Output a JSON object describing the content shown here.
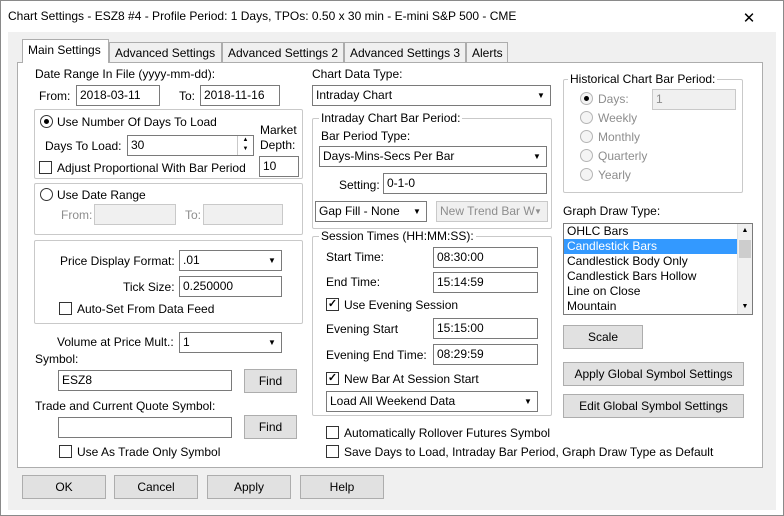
{
  "window": {
    "title": "Chart Settings - ESZ8  #4 - Profile Period: 1 Days, TPOs: 0.50 x 30 min   - E-mini S&P 500 - CME",
    "close_glyph": "✕"
  },
  "tabs": [
    "Main Settings",
    "Advanced Settings",
    "Advanced Settings 2",
    "Advanced Settings 3",
    "Alerts"
  ],
  "date_range": {
    "label": "Date Range In File (yyyy-mm-dd):",
    "from_label": "From:",
    "from_value": "2018-03-11",
    "to_label": "To:",
    "to_value": "2018-11-16",
    "use_days_label": "Use Number Of Days To Load",
    "days_to_load_label": "Days To Load:",
    "days_to_load_value": "30",
    "market_depth_label_1": "Market",
    "market_depth_label_2": "Depth:",
    "market_depth_value": "10",
    "adjust_label": "Adjust Proportional With Bar Period",
    "use_date_range_label": "Use Date Range",
    "range_from_label": "From:",
    "range_to_label": "To:"
  },
  "price": {
    "format_label": "Price Display Format:",
    "format_value": ".01",
    "tick_label": "Tick Size:",
    "tick_value": "0.250000",
    "auto_set_label": "Auto-Set From Data Feed"
  },
  "volume": {
    "label": "Volume at Price Mult.:",
    "value": "1"
  },
  "symbol": {
    "label": "Symbol:",
    "value": "ESZ8",
    "find_label": "Find"
  },
  "trade_symbol": {
    "label": "Trade and Current Quote Symbol:",
    "value": "",
    "find_label": "Find",
    "trade_only_label": "Use As Trade Only Symbol"
  },
  "chart_data_type": {
    "label": "Chart Data Type:",
    "value": "Intraday Chart"
  },
  "intraday": {
    "group_label": "Intraday Chart Bar Period:",
    "type_label": "Bar Period Type:",
    "type_value": "Days-Mins-Secs Per Bar",
    "setting_label": "Setting:",
    "setting_value": "0-1-0",
    "gap_fill_value": "Gap Fill - None",
    "new_trend_value": "New Trend Bar W"
  },
  "session": {
    "group_label": "Session Times (HH:MM:SS):",
    "start_label": "Start Time:",
    "start_value": "08:30:00",
    "end_label": "End Time:",
    "end_value": "15:14:59",
    "use_evening_label": "Use Evening Session",
    "evening_start_label": "Evening Start",
    "evening_start_value": "15:15:00",
    "evening_end_label": "Evening End Time:",
    "evening_end_value": "08:29:59",
    "new_bar_label": "New Bar At Session Start",
    "weekend_value": "Load All Weekend Data"
  },
  "rollover_label": "Automatically Rollover Futures Symbol",
  "save_defaults_label": "Save Days to Load, Intraday Bar Period, Graph Draw Type as Default",
  "historical": {
    "group_label": "Historical Chart Bar Period:",
    "days_label": "Days:",
    "days_value": "1",
    "weekly_label": "Weekly",
    "monthly_label": "Monthly",
    "quarterly_label": "Quarterly",
    "yearly_label": "Yearly"
  },
  "graph_draw": {
    "label": "Graph Draw Type:",
    "items": [
      "OHLC Bars",
      "Candlestick Bars",
      "Candlestick Body Only",
      "Candlestick Bars Hollow",
      "Line on Close",
      "Mountain"
    ],
    "selected": "Candlestick Bars"
  },
  "buttons": {
    "scale": "Scale",
    "apply_global": "Apply Global Symbol Settings",
    "edit_global": "Edit Global Symbol Settings",
    "ok": "OK",
    "cancel": "Cancel",
    "apply": "Apply",
    "help": "Help"
  },
  "colors": {
    "selection": "#3399ff",
    "dialog_bg": "#f0f0f0"
  }
}
